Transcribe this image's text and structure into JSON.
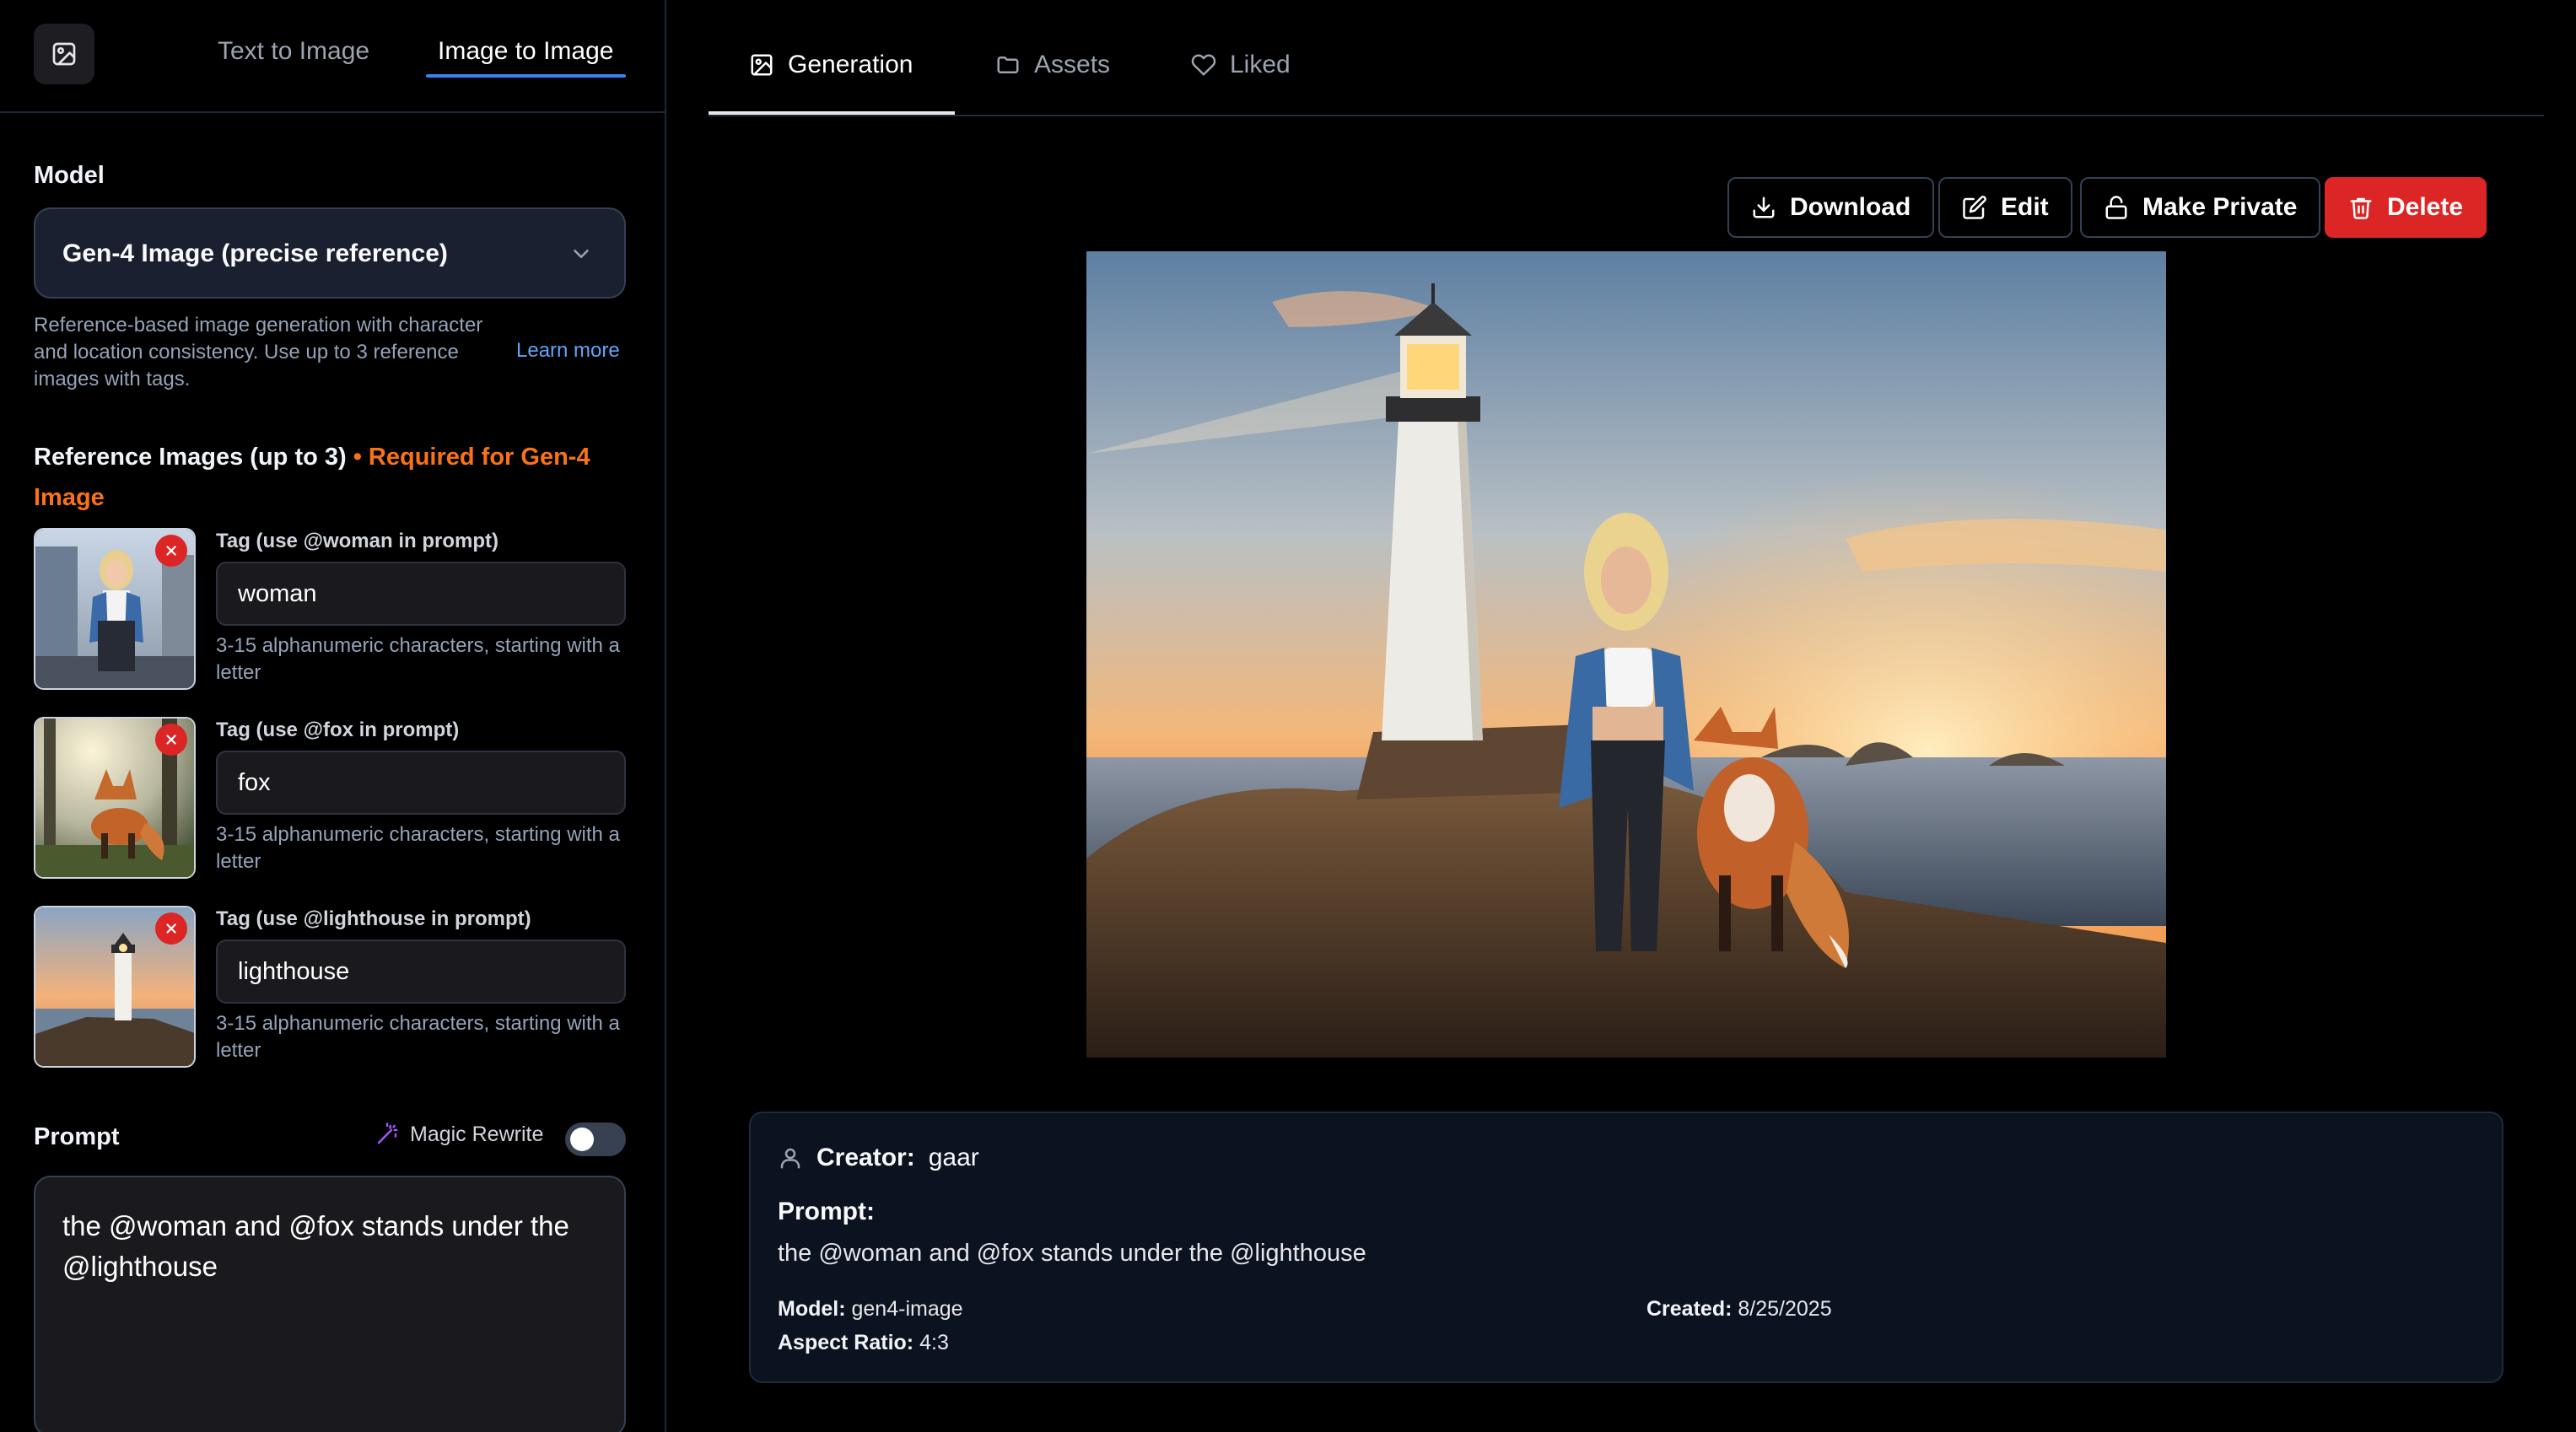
{
  "modes": {
    "text_to_image": "Text to Image",
    "image_to_image": "Image to Image"
  },
  "model": {
    "label": "Model",
    "selected": "Gen-4 Image (precise reference)",
    "help": "Reference-based image generation with character and location consistency. Use up to 3 reference images with tags.",
    "learn_more": "Learn more"
  },
  "reference": {
    "title": "Reference Images (up to 3)",
    "required": "• Required for Gen-4 Image",
    "items": [
      {
        "tag_label": "Tag (use @woman in prompt)",
        "value": "woman",
        "help": "3-15 alphanumeric characters, starting with a letter"
      },
      {
        "tag_label": "Tag (use @fox in prompt)",
        "value": "fox",
        "help": "3-15 alphanumeric characters, starting with a letter"
      },
      {
        "tag_label": "Tag (use @lighthouse in prompt)",
        "value": "lighthouse",
        "help": "3-15 alphanumeric characters, starting with a letter"
      }
    ]
  },
  "prompt": {
    "label": "Prompt",
    "magic_rewrite": "Magic Rewrite",
    "magic_rewrite_on": false,
    "value": "the @woman and @fox stands under the @lighthouse"
  },
  "tabs": {
    "generation": "Generation",
    "assets": "Assets",
    "liked": "Liked"
  },
  "actions": {
    "download": "Download",
    "edit": "Edit",
    "make_private": "Make Private",
    "delete": "Delete"
  },
  "details": {
    "creator_label": "Creator:",
    "creator": "gaar",
    "prompt_label": "Prompt:",
    "prompt": "the @woman and @fox stands under the @lighthouse",
    "model_label": "Model:",
    "model": "gen4-image",
    "aspect_label": "Aspect Ratio:",
    "aspect": "4:3",
    "created_label": "Created:",
    "created": "8/25/2025"
  },
  "colors": {
    "accent": "#3b82f6",
    "danger": "#dc2626",
    "required": "#f97316",
    "link": "#60a5fa"
  },
  "icons": [
    "image-icon",
    "chevron-down-icon",
    "close-icon",
    "wand-icon",
    "folder-icon",
    "heart-icon",
    "download-icon",
    "edit-icon",
    "lock-icon",
    "trash-icon",
    "user-icon"
  ]
}
